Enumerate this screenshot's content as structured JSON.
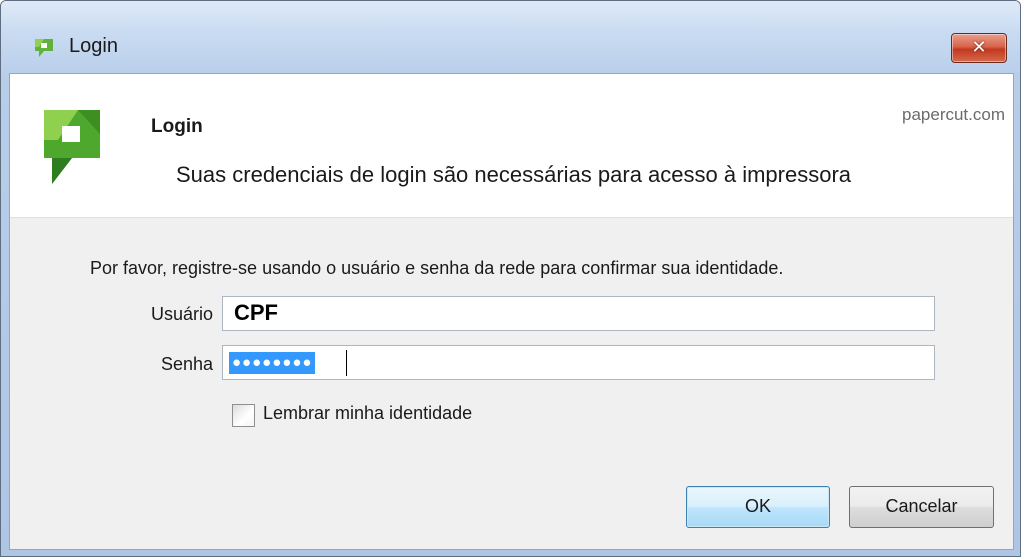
{
  "window": {
    "title": "Login",
    "close_symbol": "✕"
  },
  "header": {
    "title": "Login",
    "site": "papercut.com",
    "subtitle": "Suas credenciais de login são necessárias para acesso à impressora"
  },
  "form": {
    "instruction": "Por favor, registre-se usando o usuário e senha da rede para confirmar sua identidade.",
    "username_label": "Usuário",
    "username_value": "CPF",
    "password_label": "Senha",
    "password_masked": "●●●●●●●●",
    "remember_label": "Lembrar minha identidade",
    "remember_checked": false
  },
  "buttons": {
    "ok_label": "OK",
    "cancel_label": "Cancelar"
  },
  "colors": {
    "brand_green": "#5fb33a",
    "brand_dark_green": "#2e7d32",
    "selection_blue": "#3399ff"
  },
  "icons": {
    "title": "papercut-logo-icon",
    "header": "papercut-logo-icon",
    "close": "close-icon"
  }
}
